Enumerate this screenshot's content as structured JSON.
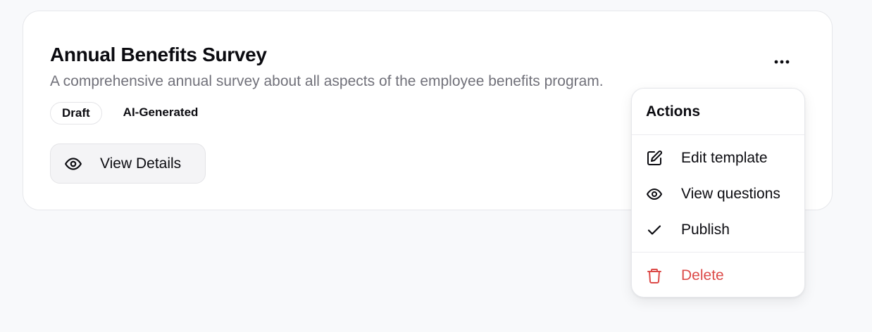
{
  "card": {
    "title": "Annual Benefits Survey",
    "description": "A comprehensive annual survey about all aspects of the employee benefits program.",
    "badges": [
      "Draft",
      "AI-Generated"
    ],
    "view_button_label": "View Details",
    "more_icon": "more-horizontal-icon"
  },
  "menu": {
    "header": "Actions",
    "items": [
      {
        "label": "Edit template",
        "icon": "edit-icon"
      },
      {
        "label": "View questions",
        "icon": "eye-icon"
      },
      {
        "label": "Publish",
        "icon": "check-icon"
      },
      {
        "label": "Delete",
        "icon": "trash-icon"
      }
    ]
  },
  "colors": {
    "danger": "#dc4a48",
    "muted_text": "#71717a",
    "background": "#f8f9fb"
  }
}
